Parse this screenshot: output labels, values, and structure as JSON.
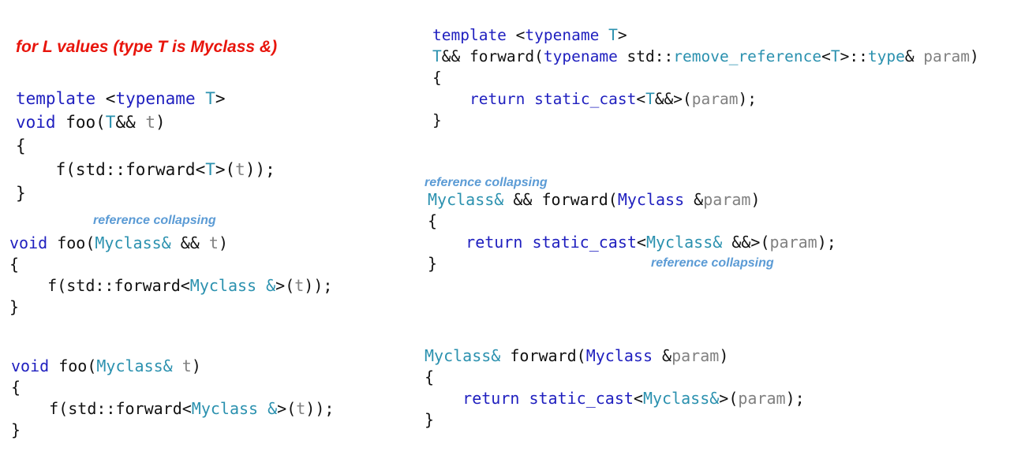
{
  "heading": "for L values (type T is Myclass &)",
  "notes": {
    "collapse_left": "reference collapsing",
    "collapse_right_top": "reference collapsing",
    "collapse_right_mid": "reference collapsing"
  },
  "colors": {
    "keyword": "#1f1fbf",
    "type": "#2b91af",
    "variable": "#808080",
    "text": "#111111",
    "heading": "#e8150c",
    "note": "#5b9bd5"
  },
  "blocks": [
    {
      "id": "b1",
      "name": "generic-foo-template",
      "lines": [
        [
          [
            "template",
            "kw"
          ],
          [
            " <",
            ""
          ],
          [
            "typename",
            "kw"
          ],
          [
            " ",
            ""
          ],
          [
            "T",
            "ty"
          ],
          [
            ">",
            ""
          ]
        ],
        [
          [
            "void",
            "kw"
          ],
          [
            " foo(",
            ""
          ],
          [
            "T",
            "ty"
          ],
          [
            "&& ",
            ""
          ],
          [
            "t",
            "vr"
          ],
          [
            ")",
            ""
          ]
        ],
        [
          [
            "{",
            ""
          ]
        ],
        [
          [
            "    f(std::forward<",
            ""
          ],
          [
            "T",
            "ty"
          ],
          [
            ">(",
            ""
          ],
          [
            "t",
            "vr"
          ],
          [
            "));",
            ""
          ]
        ],
        [
          [
            "}",
            ""
          ]
        ]
      ]
    },
    {
      "id": "b2",
      "name": "foo-myclass-ref-ref",
      "lines": [
        [
          [
            "void",
            "kw"
          ],
          [
            " foo(",
            ""
          ],
          [
            "Myclass&",
            "ty"
          ],
          [
            " && ",
            ""
          ],
          [
            "t",
            "vr"
          ],
          [
            ")",
            ""
          ]
        ],
        [
          [
            "{",
            ""
          ]
        ],
        [
          [
            "    f(std::forward<",
            ""
          ],
          [
            "Myclass &",
            "ty"
          ],
          [
            ">(",
            ""
          ],
          [
            "t",
            "vr"
          ],
          [
            "));",
            ""
          ]
        ],
        [
          [
            "}",
            ""
          ]
        ]
      ]
    },
    {
      "id": "b3",
      "name": "foo-myclass-ref",
      "lines": [
        [
          [
            "void",
            "kw"
          ],
          [
            " foo(",
            ""
          ],
          [
            "Myclass&",
            "ty"
          ],
          [
            " ",
            ""
          ],
          [
            "t",
            "vr"
          ],
          [
            ")",
            ""
          ]
        ],
        [
          [
            "{",
            ""
          ]
        ],
        [
          [
            "    f(std::forward<",
            ""
          ],
          [
            "Myclass &",
            "ty"
          ],
          [
            ">(",
            ""
          ],
          [
            "t",
            "vr"
          ],
          [
            "));",
            ""
          ]
        ],
        [
          [
            "}",
            ""
          ]
        ]
      ]
    },
    {
      "id": "b4",
      "name": "generic-forward-template",
      "lines": [
        [
          [
            "template",
            "kw"
          ],
          [
            " <",
            ""
          ],
          [
            "typename",
            "kw"
          ],
          [
            " ",
            ""
          ],
          [
            "T",
            "ty"
          ],
          [
            ">",
            ""
          ]
        ],
        [
          [
            "T",
            "ty"
          ],
          [
            "&& forward(",
            ""
          ],
          [
            "typename",
            "kw"
          ],
          [
            " std::",
            ""
          ],
          [
            "remove_reference",
            "ty"
          ],
          [
            "<",
            ""
          ],
          [
            "T",
            "ty"
          ],
          [
            ">::",
            ""
          ],
          [
            "type",
            "ty"
          ],
          [
            "& ",
            ""
          ],
          [
            "param",
            "vr"
          ],
          [
            ")",
            ""
          ]
        ],
        [
          [
            "{",
            ""
          ]
        ],
        [
          [
            "    ",
            ""
          ],
          [
            "return",
            "kw"
          ],
          [
            " ",
            ""
          ],
          [
            "static_cast",
            "kw"
          ],
          [
            "<",
            ""
          ],
          [
            "T",
            "ty"
          ],
          [
            "&&>(",
            ""
          ],
          [
            "param",
            "vr"
          ],
          [
            ");",
            ""
          ]
        ],
        [
          [
            "}",
            ""
          ]
        ]
      ]
    },
    {
      "id": "b5",
      "name": "forward-myclass-ref-ref",
      "lines": [
        [
          [
            "Myclass&",
            "ty"
          ],
          [
            " && forward(",
            ""
          ],
          [
            "Myclass",
            "kw"
          ],
          [
            " &",
            ""
          ],
          [
            "param",
            "vr"
          ],
          [
            ")",
            ""
          ]
        ],
        [
          [
            "{",
            ""
          ]
        ],
        [
          [
            "    ",
            ""
          ],
          [
            "return",
            "kw"
          ],
          [
            " ",
            ""
          ],
          [
            "static_cast",
            "kw"
          ],
          [
            "<",
            ""
          ],
          [
            "Myclass&",
            "ty"
          ],
          [
            " &&>(",
            ""
          ],
          [
            "param",
            "vr"
          ],
          [
            ");",
            ""
          ]
        ],
        [
          [
            "}",
            ""
          ]
        ]
      ]
    },
    {
      "id": "b6",
      "name": "forward-myclass-ref",
      "lines": [
        [
          [
            "Myclass&",
            "ty"
          ],
          [
            " forward(",
            ""
          ],
          [
            "Myclass",
            "kw"
          ],
          [
            " &",
            ""
          ],
          [
            "param",
            "vr"
          ],
          [
            ")",
            ""
          ]
        ],
        [
          [
            "{",
            ""
          ]
        ],
        [
          [
            "    ",
            ""
          ],
          [
            "return",
            "kw"
          ],
          [
            " ",
            ""
          ],
          [
            "static_cast",
            "kw"
          ],
          [
            "<",
            ""
          ],
          [
            "Myclass&",
            "ty"
          ],
          [
            ">(",
            ""
          ],
          [
            "param",
            "vr"
          ],
          [
            ");",
            ""
          ]
        ],
        [
          [
            "}",
            ""
          ]
        ]
      ]
    }
  ]
}
